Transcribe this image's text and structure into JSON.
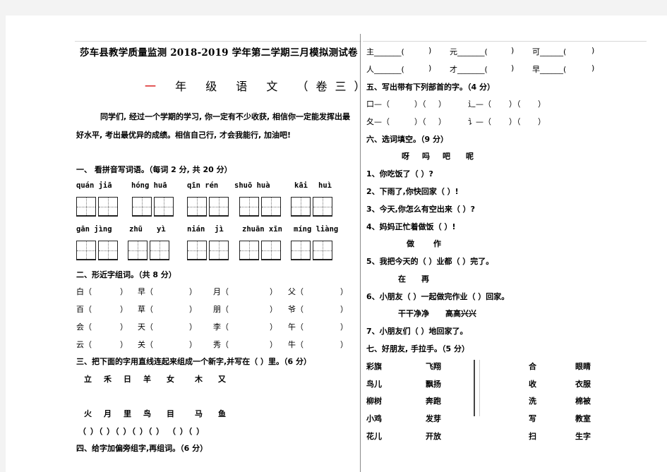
{
  "header": {
    "title": "莎车县教学质量监测 2018-2019 学年第二学期三月模拟测试卷",
    "subtitle_first": "一",
    "subtitle_rest": "年 级 语 文 （卷三）"
  },
  "intro": {
    "line1": "同学们, 经过一个学期的学习, 你一定有不少收获, 相信你一定能发挥出最",
    "line2": "好水平, 考出最优异的成绩。相信自己行, 才会我能行, 加油吧!"
  },
  "section1": {
    "heading": "一、  看拼音写词语。（每词 2 分, 共 20 分）",
    "row1": [
      "quán  jiā",
      "hóng huā",
      "qīn rén",
      "shuō huà",
      "kāi",
      "huì"
    ],
    "row2": [
      "gān jìng",
      "zhū",
      "yì",
      "nián",
      "jì",
      "zhuān xīn",
      "míng liàng"
    ]
  },
  "section2": {
    "heading": "二、形近字组词。（共 8 分）",
    "rows": [
      [
        "白（",
        "）",
        "早（",
        "）",
        "月（",
        "）",
        "父（",
        "）"
      ],
      [
        "百（",
        "）",
        "草（",
        "）",
        "朋（",
        "）",
        "爷（",
        "）"
      ],
      [
        "会（",
        "）",
        "天（",
        "）",
        "李（",
        "）",
        "午（",
        "）"
      ],
      [
        "云（",
        "）",
        "关（",
        "）",
        "秀（",
        "）",
        "牛（",
        "）"
      ]
    ]
  },
  "section3": {
    "heading": "三、把下面的字用直线连起来组成一个新字,并写在（  ）里。（6 分）",
    "top": [
      "立",
      "禾",
      "日",
      "羊",
      "女",
      "木",
      "又"
    ],
    "bottom": [
      "火",
      "月",
      "里",
      "鸟",
      "目",
      "马",
      "鱼"
    ],
    "blanks": "（ ）（ ）（ ）（  ）（  ）  （  ）（  ）"
  },
  "section4": {
    "heading": "四、给字加偏旁组字,再组词。（6 分）",
    "rows": [
      [
        "主_______(",
        ")",
        "元_______(",
        ")",
        "可______(",
        ")"
      ],
      [
        "人_______(",
        ")",
        "才_______(",
        ")",
        "早______(",
        ")"
      ]
    ]
  },
  "section5": {
    "heading": "五、写出带有下列部首的字。（4 分）",
    "rows": [
      [
        "口—（",
        "）（",
        "）",
        "辶—（",
        "）（",
        "）"
      ],
      [
        "夂—（",
        "）（",
        "）",
        "讠—（",
        "）（",
        "）"
      ]
    ]
  },
  "section6": {
    "heading": "六、选词填空。（9 分）",
    "options1": [
      "呀",
      "吗",
      "吧",
      "呢"
    ],
    "q1": "1、你吃饭了（    ）?",
    "q2": "2、下雨了,你快回家（    ）!",
    "q3": "3、今天,你怎么有空出来（   ）?",
    "q4": "4、妈妈正忙着做饭（    ）!",
    "options2": [
      "做",
      "作"
    ],
    "q5": "5、我把今天的（      ）业都（      ）完了。",
    "options3": [
      "在",
      "再"
    ],
    "q6": "6、小朋友（    ）一起做完作业（    ）回家。",
    "options4": [
      "干干净净",
      "高高兴兴"
    ],
    "q7": "7、小朋友们（              ）地回家了。"
  },
  "section7": {
    "heading": "七、好朋友, 手拉手。（5 分）",
    "left_a": [
      "彩旗",
      "鸟儿",
      "柳树",
      "小鸡",
      "花儿"
    ],
    "left_b": [
      "飞翔",
      "飘扬",
      "奔跑",
      "发芽",
      "开放"
    ],
    "right_a": [
      "合",
      "收",
      "洗",
      "写",
      "扫"
    ],
    "right_b": [
      "眼睛",
      "衣服",
      "棉被",
      "教室",
      "生字"
    ]
  }
}
